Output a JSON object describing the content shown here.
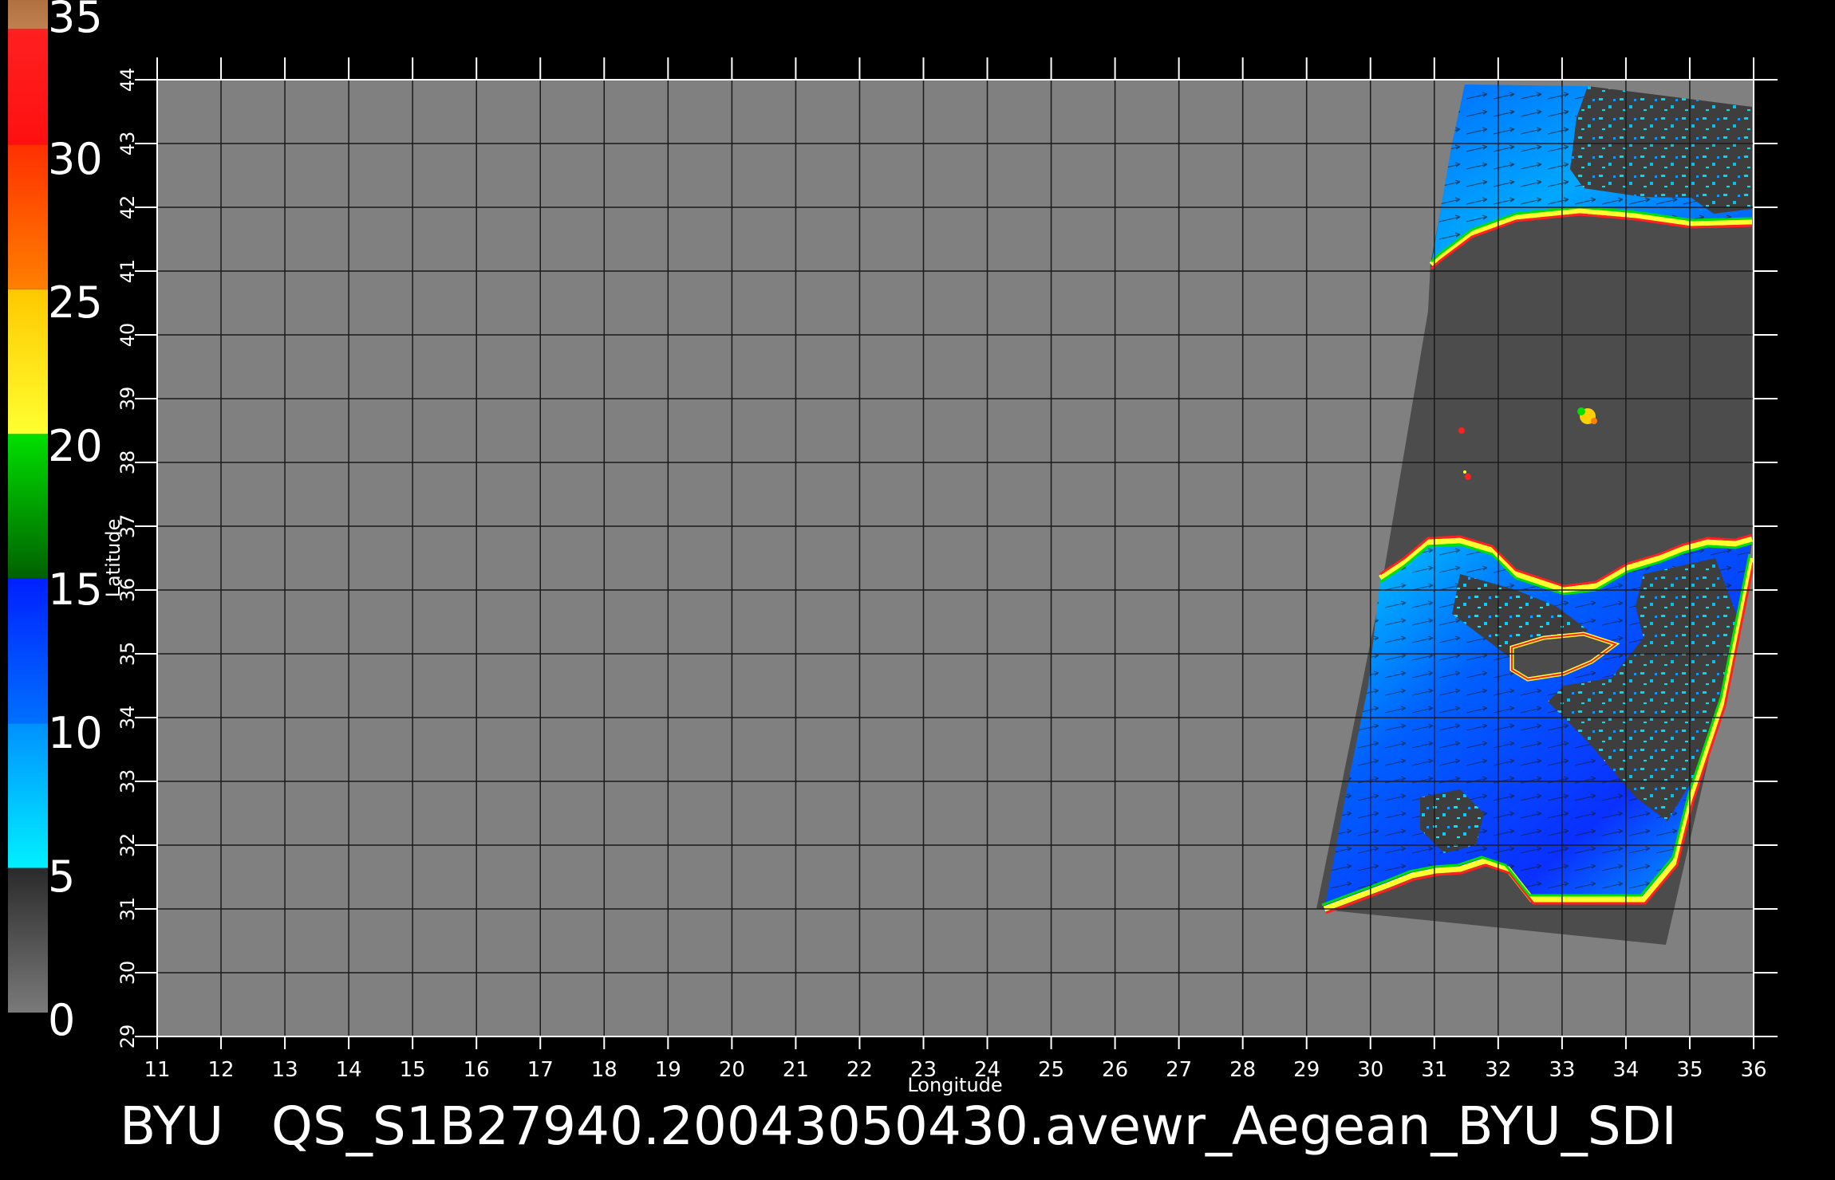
{
  "colorbar": {
    "ticks": [
      "35",
      "30",
      "25",
      "20",
      "15",
      "10",
      "5",
      "0"
    ],
    "segments": [
      {
        "lo": 0,
        "hi": 5,
        "from": "#7a7a7a",
        "to": "#2a2a2a"
      },
      {
        "lo": 5,
        "hi": 10,
        "from": "#00f0ff",
        "to": "#0090ff"
      },
      {
        "lo": 10,
        "hi": 15,
        "from": "#0070ff",
        "to": "#0020ff"
      },
      {
        "lo": 15,
        "hi": 20,
        "from": "#006000",
        "to": "#00e000"
      },
      {
        "lo": 20,
        "hi": 25,
        "from": "#ffff30",
        "to": "#ffc800"
      },
      {
        "lo": 25,
        "hi": 30,
        "from": "#ff8000",
        "to": "#ff3000"
      },
      {
        "lo": 30,
        "hi": 34,
        "from": "#ff1010",
        "to": "#ff2020"
      },
      {
        "lo": 34,
        "hi": 35,
        "from": "#c08050",
        "to": "#b07040"
      }
    ]
  },
  "axes": {
    "xlabel": "Longitude",
    "ylabel": "Latitude",
    "xlim": [
      11,
      36
    ],
    "ylim": [
      29,
      44
    ],
    "xticks": [
      "11",
      "12",
      "13",
      "14",
      "15",
      "16",
      "17",
      "18",
      "19",
      "20",
      "21",
      "22",
      "23",
      "24",
      "25",
      "26",
      "27",
      "28",
      "29",
      "30",
      "31",
      "32",
      "33",
      "34",
      "35",
      "36"
    ],
    "yticks": [
      "29",
      "30",
      "31",
      "32",
      "33",
      "34",
      "35",
      "36",
      "37",
      "38",
      "39",
      "40",
      "41",
      "42",
      "43",
      "44"
    ]
  },
  "footer": {
    "left": "BYU",
    "filename": "QS_S1B27940.20043050430.avewr_Aegean_BYU_SDI"
  },
  "colors": {
    "background": "#000000",
    "map_fill": "#808080",
    "gridline": "#1a1a1a",
    "swath_land": "#4c4c4c",
    "text": "#ffffff"
  }
}
